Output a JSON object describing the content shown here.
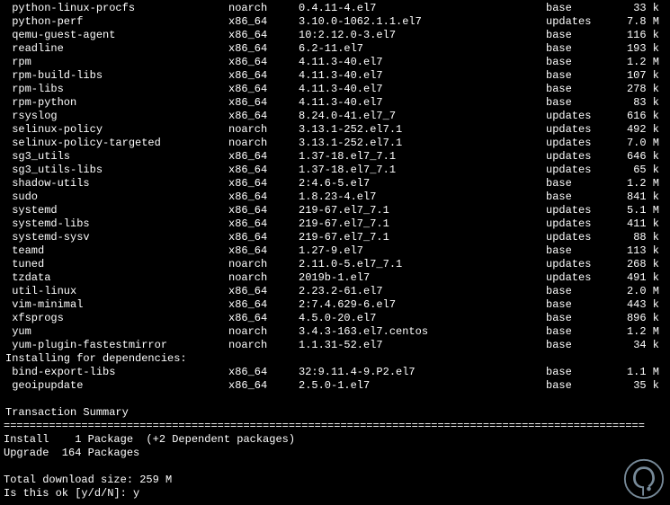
{
  "packages": [
    {
      "name": " python-linux-procfs",
      "arch": "noarch",
      "ver": "0.4.11-4.el7",
      "repo": "base",
      "size": "33 k"
    },
    {
      "name": " python-perf",
      "arch": "x86_64",
      "ver": "3.10.0-1062.1.1.el7",
      "repo": "updates",
      "size": "7.8 M"
    },
    {
      "name": " qemu-guest-agent",
      "arch": "x86_64",
      "ver": "10:2.12.0-3.el7",
      "repo": "base",
      "size": "116 k"
    },
    {
      "name": " readline",
      "arch": "x86_64",
      "ver": "6.2-11.el7",
      "repo": "base",
      "size": "193 k"
    },
    {
      "name": " rpm",
      "arch": "x86_64",
      "ver": "4.11.3-40.el7",
      "repo": "base",
      "size": "1.2 M"
    },
    {
      "name": " rpm-build-libs",
      "arch": "x86_64",
      "ver": "4.11.3-40.el7",
      "repo": "base",
      "size": "107 k"
    },
    {
      "name": " rpm-libs",
      "arch": "x86_64",
      "ver": "4.11.3-40.el7",
      "repo": "base",
      "size": "278 k"
    },
    {
      "name": " rpm-python",
      "arch": "x86_64",
      "ver": "4.11.3-40.el7",
      "repo": "base",
      "size": "83 k"
    },
    {
      "name": " rsyslog",
      "arch": "x86_64",
      "ver": "8.24.0-41.el7_7",
      "repo": "updates",
      "size": "616 k"
    },
    {
      "name": " selinux-policy",
      "arch": "noarch",
      "ver": "3.13.1-252.el7.1",
      "repo": "updates",
      "size": "492 k"
    },
    {
      "name": " selinux-policy-targeted",
      "arch": "noarch",
      "ver": "3.13.1-252.el7.1",
      "repo": "updates",
      "size": "7.0 M"
    },
    {
      "name": " sg3_utils",
      "arch": "x86_64",
      "ver": "1.37-18.el7_7.1",
      "repo": "updates",
      "size": "646 k"
    },
    {
      "name": " sg3_utils-libs",
      "arch": "x86_64",
      "ver": "1.37-18.el7_7.1",
      "repo": "updates",
      "size": "65 k"
    },
    {
      "name": " shadow-utils",
      "arch": "x86_64",
      "ver": "2:4.6-5.el7",
      "repo": "base",
      "size": "1.2 M"
    },
    {
      "name": " sudo",
      "arch": "x86_64",
      "ver": "1.8.23-4.el7",
      "repo": "base",
      "size": "841 k"
    },
    {
      "name": " systemd",
      "arch": "x86_64",
      "ver": "219-67.el7_7.1",
      "repo": "updates",
      "size": "5.1 M"
    },
    {
      "name": " systemd-libs",
      "arch": "x86_64",
      "ver": "219-67.el7_7.1",
      "repo": "updates",
      "size": "411 k"
    },
    {
      "name": " systemd-sysv",
      "arch": "x86_64",
      "ver": "219-67.el7_7.1",
      "repo": "updates",
      "size": "88 k"
    },
    {
      "name": " teamd",
      "arch": "x86_64",
      "ver": "1.27-9.el7",
      "repo": "base",
      "size": "113 k"
    },
    {
      "name": " tuned",
      "arch": "noarch",
      "ver": "2.11.0-5.el7_7.1",
      "repo": "updates",
      "size": "268 k"
    },
    {
      "name": " tzdata",
      "arch": "noarch",
      "ver": "2019b-1.el7",
      "repo": "updates",
      "size": "491 k"
    },
    {
      "name": " util-linux",
      "arch": "x86_64",
      "ver": "2.23.2-61.el7",
      "repo": "base",
      "size": "2.0 M"
    },
    {
      "name": " vim-minimal",
      "arch": "x86_64",
      "ver": "2:7.4.629-6.el7",
      "repo": "base",
      "size": "443 k"
    },
    {
      "name": " xfsprogs",
      "arch": "x86_64",
      "ver": "4.5.0-20.el7",
      "repo": "base",
      "size": "896 k"
    },
    {
      "name": " yum",
      "arch": "noarch",
      "ver": "3.4.3-163.el7.centos",
      "repo": "base",
      "size": "1.2 M"
    },
    {
      "name": " yum-plugin-fastestmirror",
      "arch": "noarch",
      "ver": "1.1.31-52.el7",
      "repo": "base",
      "size": "34 k"
    }
  ],
  "deps_header": "Installing for dependencies:",
  "deps": [
    {
      "name": " bind-export-libs",
      "arch": "x86_64",
      "ver": "32:9.11.4-9.P2.el7",
      "repo": "base",
      "size": "1.1 M"
    },
    {
      "name": " geoipupdate",
      "arch": "x86_64",
      "ver": "2.5.0-1.el7",
      "repo": "base",
      "size": "35 k"
    }
  ],
  "summary_title": "Transaction Summary",
  "divider": "===================================================================================================",
  "install_line": "Install    1 Package  (+2 Dependent packages)",
  "upgrade_line": "Upgrade  164 Packages",
  "download_line": "Total download size: 259 M",
  "prompt": "Is this ok [y/d/N]: y"
}
